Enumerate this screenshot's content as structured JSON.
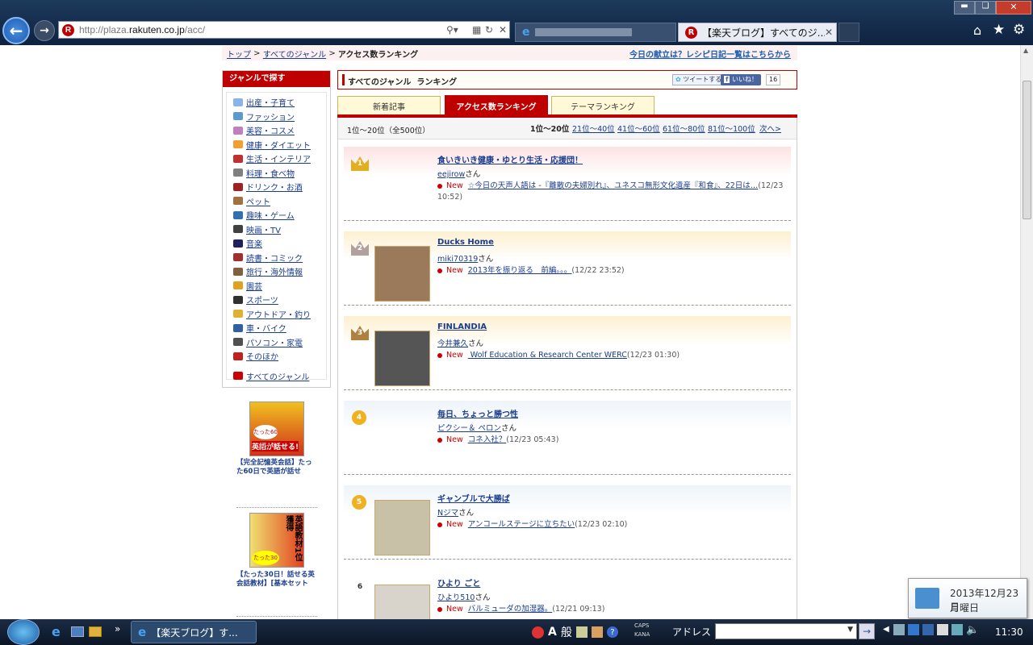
{
  "browser": {
    "url_prefix": "http://plaza.",
    "url_domain": "rakuten.co.jp",
    "url_path": "/acc/",
    "tab_active_title": "【楽天ブログ】すべてのジ..."
  },
  "breadcrumb": {
    "top": "トップ",
    "sep": " > ",
    "all_genres": "すべてのジャンル",
    "current": "アクセス数ランキング",
    "promo_link": "今日の献立は？レシピ日記一覧はこちらから"
  },
  "sidebar": {
    "header": "ジャンルで探す",
    "genres": [
      {
        "label": "出産・子育て",
        "color": "#8ab4e8"
      },
      {
        "label": "ファッション",
        "color": "#5a9ad0"
      },
      {
        "label": "美容・コスメ",
        "color": "#c080c0"
      },
      {
        "label": "健康・ダイエット",
        "color": "#f0a030"
      },
      {
        "label": "生活・インテリア",
        "color": "#c03030"
      },
      {
        "label": "料理・食べ物",
        "color": "#808080"
      },
      {
        "label": "ドリンク・お酒",
        "color": "#a02020"
      },
      {
        "label": "ペット",
        "color": "#a07040"
      },
      {
        "label": "趣味・ゲーム",
        "color": "#3070b0"
      },
      {
        "label": "映画・TV",
        "color": "#404040"
      },
      {
        "label": "音楽",
        "color": "#202060"
      },
      {
        "label": "読書・コミック",
        "color": "#a03030"
      },
      {
        "label": "旅行・海外情報",
        "color": "#806040"
      },
      {
        "label": "園芸",
        "color": "#e0a020"
      },
      {
        "label": "スポーツ",
        "color": "#303030"
      },
      {
        "label": "アウトドア・釣り",
        "color": "#e0b030"
      },
      {
        "label": "車・バイク",
        "color": "#3060a0"
      },
      {
        "label": "パソコン・家電",
        "color": "#505050"
      },
      {
        "label": "そのほか",
        "color": "#c02020"
      }
    ],
    "all_genres": "すべてのジャンル",
    "ad1_caption": "【完全記憶英会話】たった60日で英語が話せ",
    "ad1_badge": "たった60日で",
    "ad1_text": "英語が話せる!",
    "ad2_caption": "【たった30日！話せる英会話教材】[基本セット",
    "ad2_text": "英語教材1位獲得",
    "ad2_badge": "たった30日で"
  },
  "ranking": {
    "title": "すべてのジャンル  ランキング",
    "tweet": "ツイートする",
    "like": "いいね！",
    "like_count": "16",
    "tabs": [
      "新着記事",
      "アクセス数ランキング",
      "テーマランキング"
    ],
    "range_label": "1位〜20位（全500位）",
    "pager_current": "1位〜20位",
    "pager_links": [
      "21位〜40位",
      "41位〜60位",
      "61位〜80位",
      "81位〜100位"
    ],
    "pager_next": "次へ>",
    "new_label": "New",
    "san": "さん",
    "entries": [
      {
        "rank": "1",
        "title": "食いきいき健康・ゆとり生活・応援団！",
        "author": "eejirow",
        "post": "☆今日の天声人語は -『離散の夫婦別れ』、ユネスコ無形文化遺産『和食』、22日は…",
        "date": "(12/23 10:52)"
      },
      {
        "rank": "2",
        "title": "Ducks Home",
        "author": "miki70319",
        "post": "2013年を振り返る　前編。。。",
        "date": "(12/22 23:52)"
      },
      {
        "rank": "3",
        "title": "FINLANDIA",
        "author": "今井兼久",
        "post": " Wolf Education & Research Center WERC",
        "date": "(12/23 01:30)"
      },
      {
        "rank": "4",
        "title": "毎日、ちょっと勝つ性",
        "author": "ピクシー＆ ペロン",
        "post": "コネ入社？",
        "date": "(12/23 05:43)"
      },
      {
        "rank": "5",
        "title": "ギャンブルで大勝ば",
        "author": "Nジマ",
        "post": "アンコールステージに立ちたい",
        "date": "(12/23 02:10)"
      },
      {
        "rank": "6",
        "title": "ひより ごと",
        "author": "ひより510",
        "post": "バルミューダの加湿器。",
        "date": "(12/21 09:13)"
      }
    ]
  },
  "taskbar": {
    "window_title": "【楽天ブログ】す...",
    "ime_mode": "A",
    "ime_label": "般",
    "caps": "CAPS",
    "kana": "KANA",
    "address_label": "アドレス",
    "clock": "11:30",
    "date_tooltip_date": "2013年12月23日",
    "date_tooltip_day": "月曜日"
  }
}
